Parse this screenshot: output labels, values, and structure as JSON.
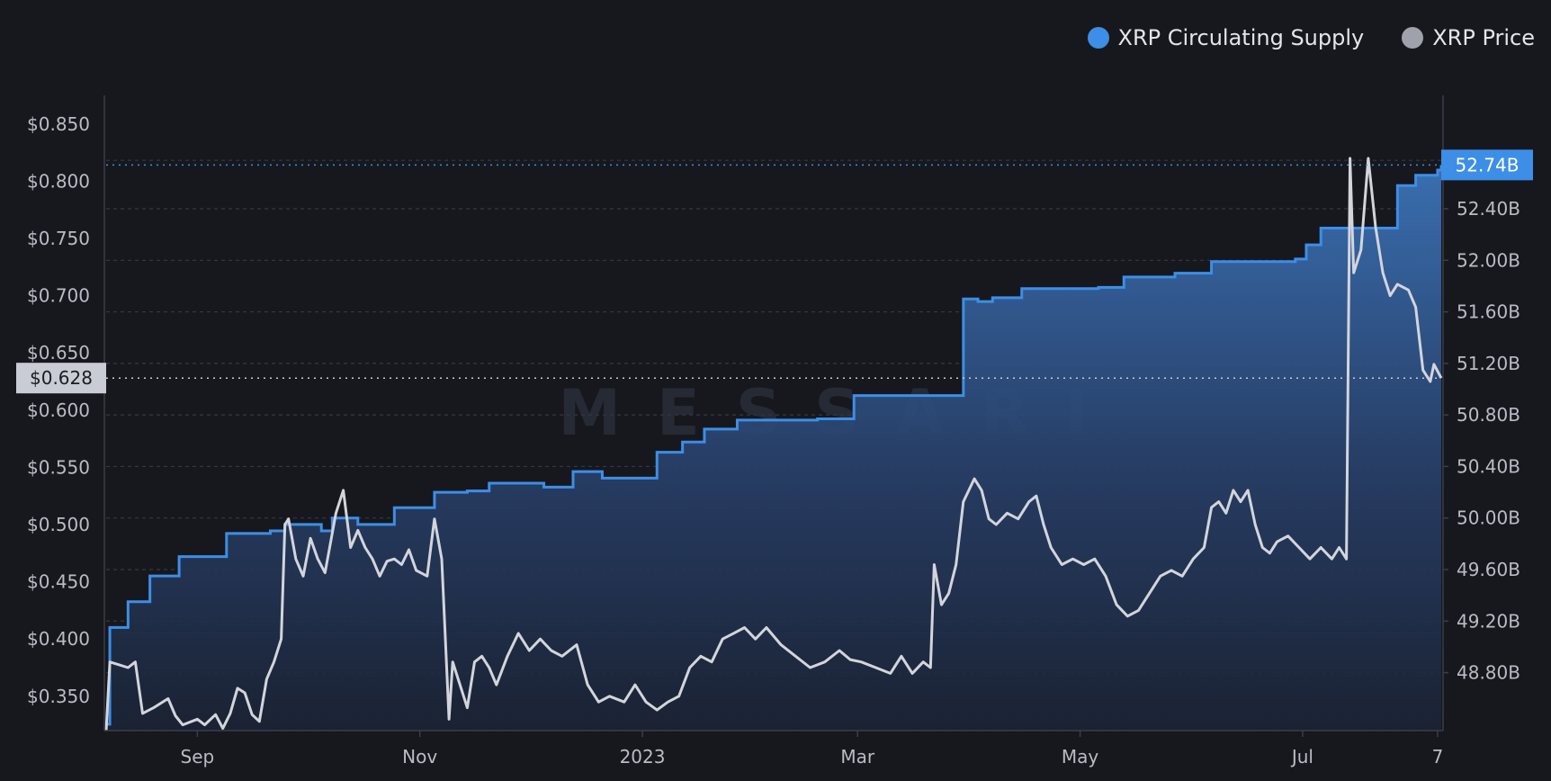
{
  "legend": {
    "supply_label": "XRP Circulating Supply",
    "price_label": "XRP Price"
  },
  "colors": {
    "supply": "#3d8ee6",
    "price": "#d3d5dc",
    "background": "#17181d",
    "price_badge_bg": "#c9ccd4",
    "supply_badge_bg": "#3d8ee6"
  },
  "watermark": "MESSARI",
  "chart_data": {
    "type": "line",
    "title": "",
    "xlabel": "",
    "x_ticks": [
      {
        "label": "Sep",
        "date": "2022-09-01"
      },
      {
        "label": "Nov",
        "date": "2022-11-01"
      },
      {
        "label": "2023",
        "date": "2023-01-01"
      },
      {
        "label": "Mar",
        "date": "2023-03-01"
      },
      {
        "label": "May",
        "date": "2023-05-01"
      },
      {
        "label": "Jul",
        "date": "2023-07-01"
      },
      {
        "label": "7",
        "date": "2023-08-07"
      }
    ],
    "x_range": [
      "2022-08-07",
      "2023-08-08"
    ],
    "y_left": {
      "ylim": [
        0.32,
        0.875
      ],
      "ticks": [
        "$0.350",
        "$0.400",
        "$0.450",
        "$0.500",
        "$0.550",
        "$0.600",
        "$0.650",
        "$0.700",
        "$0.750",
        "$0.800",
        "$0.850"
      ],
      "tick_values": [
        0.35,
        0.4,
        0.45,
        0.5,
        0.55,
        0.6,
        0.65,
        0.7,
        0.75,
        0.8,
        0.85
      ],
      "current_label": "$0.628",
      "current_value": 0.628
    },
    "y_right": {
      "ylim": [
        48.35,
        53.28
      ],
      "ticks": [
        "48.80B",
        "49.20B",
        "49.60B",
        "50.00B",
        "50.40B",
        "50.80B",
        "51.20B",
        "51.60B",
        "52.00B",
        "52.40B"
      ],
      "tick_values": [
        48.8,
        49.2,
        49.6,
        50.0,
        50.4,
        50.8,
        51.2,
        51.6,
        52.0,
        52.4
      ],
      "current_label": "52.74B",
      "current_value": 52.74
    },
    "series": [
      {
        "name": "XRP Circulating Supply",
        "axis": "right",
        "style": "step-area",
        "points": [
          [
            "2022-08-07",
            48.4
          ],
          [
            "2022-08-08",
            49.15
          ],
          [
            "2022-08-13",
            49.35
          ],
          [
            "2022-08-19",
            49.55
          ],
          [
            "2022-08-27",
            49.7
          ],
          [
            "2022-09-09",
            49.88
          ],
          [
            "2022-09-21",
            49.9
          ],
          [
            "2022-09-25",
            49.95
          ],
          [
            "2022-10-05",
            49.9
          ],
          [
            "2022-10-08",
            50.0
          ],
          [
            "2022-10-15",
            49.95
          ],
          [
            "2022-10-25",
            50.08
          ],
          [
            "2022-11-05",
            50.2
          ],
          [
            "2022-11-14",
            50.21
          ],
          [
            "2022-11-20",
            50.27
          ],
          [
            "2022-12-05",
            50.24
          ],
          [
            "2022-12-13",
            50.36
          ],
          [
            "2022-12-21",
            50.31
          ],
          [
            "2023-01-05",
            50.51
          ],
          [
            "2023-01-12",
            50.59
          ],
          [
            "2023-01-18",
            50.69
          ],
          [
            "2023-01-27",
            50.76
          ],
          [
            "2023-02-18",
            50.77
          ],
          [
            "2023-02-28",
            50.95
          ],
          [
            "2023-03-30",
            51.7
          ],
          [
            "2023-04-03",
            51.68
          ],
          [
            "2023-04-07",
            51.71
          ],
          [
            "2023-04-15",
            51.78
          ],
          [
            "2023-05-06",
            51.79
          ],
          [
            "2023-05-13",
            51.87
          ],
          [
            "2023-05-27",
            51.9
          ],
          [
            "2023-06-06",
            51.99
          ],
          [
            "2023-06-29",
            52.01
          ],
          [
            "2023-07-02",
            52.12
          ],
          [
            "2023-07-06",
            52.25
          ],
          [
            "2023-07-27",
            52.58
          ],
          [
            "2023-08-01",
            52.66
          ],
          [
            "2023-08-07",
            52.7
          ],
          [
            "2023-08-08",
            52.74
          ]
        ]
      },
      {
        "name": "XRP Price",
        "axis": "left",
        "style": "line",
        "points": [
          [
            "2022-08-07",
            0.32
          ],
          [
            "2022-08-08",
            0.38
          ],
          [
            "2022-08-10",
            0.378
          ],
          [
            "2022-08-13",
            0.375
          ],
          [
            "2022-08-15",
            0.38
          ],
          [
            "2022-08-17",
            0.335
          ],
          [
            "2022-08-20",
            0.34
          ],
          [
            "2022-08-24",
            0.348
          ],
          [
            "2022-08-26",
            0.333
          ],
          [
            "2022-08-28",
            0.325
          ],
          [
            "2022-09-01",
            0.33
          ],
          [
            "2022-09-03",
            0.325
          ],
          [
            "2022-09-06",
            0.334
          ],
          [
            "2022-09-08",
            0.322
          ],
          [
            "2022-09-10",
            0.335
          ],
          [
            "2022-09-12",
            0.357
          ],
          [
            "2022-09-14",
            0.353
          ],
          [
            "2022-09-16",
            0.334
          ],
          [
            "2022-09-18",
            0.328
          ],
          [
            "2022-09-20",
            0.365
          ],
          [
            "2022-09-22",
            0.38
          ],
          [
            "2022-09-24",
            0.4
          ],
          [
            "2022-09-25",
            0.5
          ],
          [
            "2022-09-26",
            0.505
          ],
          [
            "2022-09-28",
            0.47
          ],
          [
            "2022-09-30",
            0.455
          ],
          [
            "2022-10-02",
            0.488
          ],
          [
            "2022-10-04",
            0.47
          ],
          [
            "2022-10-06",
            0.458
          ],
          [
            "2022-10-09",
            0.51
          ],
          [
            "2022-10-11",
            0.53
          ],
          [
            "2022-10-13",
            0.48
          ],
          [
            "2022-10-15",
            0.495
          ],
          [
            "2022-10-17",
            0.48
          ],
          [
            "2022-10-19",
            0.47
          ],
          [
            "2022-10-21",
            0.455
          ],
          [
            "2022-10-23",
            0.468
          ],
          [
            "2022-10-25",
            0.47
          ],
          [
            "2022-10-27",
            0.465
          ],
          [
            "2022-10-29",
            0.478
          ],
          [
            "2022-10-31",
            0.46
          ],
          [
            "2022-11-03",
            0.455
          ],
          [
            "2022-11-05",
            0.505
          ],
          [
            "2022-11-07",
            0.47
          ],
          [
            "2022-11-09",
            0.33
          ],
          [
            "2022-11-10",
            0.38
          ],
          [
            "2022-11-12",
            0.36
          ],
          [
            "2022-11-14",
            0.34
          ],
          [
            "2022-11-16",
            0.38
          ],
          [
            "2022-11-18",
            0.385
          ],
          [
            "2022-11-20",
            0.375
          ],
          [
            "2022-11-22",
            0.36
          ],
          [
            "2022-11-25",
            0.385
          ],
          [
            "2022-11-28",
            0.405
          ],
          [
            "2022-12-01",
            0.39
          ],
          [
            "2022-12-04",
            0.4
          ],
          [
            "2022-12-07",
            0.39
          ],
          [
            "2022-12-10",
            0.385
          ],
          [
            "2022-12-14",
            0.395
          ],
          [
            "2022-12-17",
            0.36
          ],
          [
            "2022-12-20",
            0.345
          ],
          [
            "2022-12-23",
            0.35
          ],
          [
            "2022-12-27",
            0.345
          ],
          [
            "2022-12-30",
            0.36
          ],
          [
            "2023-01-02",
            0.345
          ],
          [
            "2023-01-05",
            0.338
          ],
          [
            "2023-01-08",
            0.345
          ],
          [
            "2023-01-11",
            0.35
          ],
          [
            "2023-01-14",
            0.375
          ],
          [
            "2023-01-17",
            0.385
          ],
          [
            "2023-01-20",
            0.38
          ],
          [
            "2023-01-23",
            0.4
          ],
          [
            "2023-01-26",
            0.405
          ],
          [
            "2023-01-29",
            0.41
          ],
          [
            "2023-02-01",
            0.4
          ],
          [
            "2023-02-04",
            0.41
          ],
          [
            "2023-02-08",
            0.395
          ],
          [
            "2023-02-12",
            0.385
          ],
          [
            "2023-02-16",
            0.375
          ],
          [
            "2023-02-20",
            0.38
          ],
          [
            "2023-02-24",
            0.39
          ],
          [
            "2023-02-27",
            0.382
          ],
          [
            "2023-03-02",
            0.38
          ],
          [
            "2023-03-06",
            0.375
          ],
          [
            "2023-03-10",
            0.37
          ],
          [
            "2023-03-13",
            0.385
          ],
          [
            "2023-03-16",
            0.37
          ],
          [
            "2023-03-19",
            0.38
          ],
          [
            "2023-03-21",
            0.375
          ],
          [
            "2023-03-22",
            0.465
          ],
          [
            "2023-03-24",
            0.43
          ],
          [
            "2023-03-26",
            0.44
          ],
          [
            "2023-03-28",
            0.465
          ],
          [
            "2023-03-30",
            0.52
          ],
          [
            "2023-04-02",
            0.54
          ],
          [
            "2023-04-04",
            0.53
          ],
          [
            "2023-04-06",
            0.505
          ],
          [
            "2023-04-08",
            0.5
          ],
          [
            "2023-04-11",
            0.51
          ],
          [
            "2023-04-14",
            0.505
          ],
          [
            "2023-04-17",
            0.52
          ],
          [
            "2023-04-19",
            0.525
          ],
          [
            "2023-04-21",
            0.5
          ],
          [
            "2023-04-23",
            0.48
          ],
          [
            "2023-04-26",
            0.465
          ],
          [
            "2023-04-29",
            0.47
          ],
          [
            "2023-05-02",
            0.465
          ],
          [
            "2023-05-05",
            0.47
          ],
          [
            "2023-05-08",
            0.455
          ],
          [
            "2023-05-11",
            0.43
          ],
          [
            "2023-05-14",
            0.42
          ],
          [
            "2023-05-17",
            0.425
          ],
          [
            "2023-05-20",
            0.44
          ],
          [
            "2023-05-23",
            0.455
          ],
          [
            "2023-05-26",
            0.46
          ],
          [
            "2023-05-29",
            0.455
          ],
          [
            "2023-06-01",
            0.47
          ],
          [
            "2023-06-04",
            0.48
          ],
          [
            "2023-06-06",
            0.515
          ],
          [
            "2023-06-08",
            0.52
          ],
          [
            "2023-06-10",
            0.51
          ],
          [
            "2023-06-12",
            0.53
          ],
          [
            "2023-06-14",
            0.52
          ],
          [
            "2023-06-16",
            0.53
          ],
          [
            "2023-06-18",
            0.5
          ],
          [
            "2023-06-20",
            0.48
          ],
          [
            "2023-06-22",
            0.475
          ],
          [
            "2023-06-24",
            0.485
          ],
          [
            "2023-06-27",
            0.49
          ],
          [
            "2023-06-30",
            0.48
          ],
          [
            "2023-07-03",
            0.47
          ],
          [
            "2023-07-06",
            0.48
          ],
          [
            "2023-07-09",
            0.47
          ],
          [
            "2023-07-11",
            0.48
          ],
          [
            "2023-07-13",
            0.47
          ],
          [
            "2023-07-14",
            0.82
          ],
          [
            "2023-07-15",
            0.72
          ],
          [
            "2023-07-17",
            0.74
          ],
          [
            "2023-07-19",
            0.82
          ],
          [
            "2023-07-21",
            0.76
          ],
          [
            "2023-07-23",
            0.72
          ],
          [
            "2023-07-25",
            0.7
          ],
          [
            "2023-07-27",
            0.71
          ],
          [
            "2023-07-30",
            0.705
          ],
          [
            "2023-08-01",
            0.69
          ],
          [
            "2023-08-03",
            0.635
          ],
          [
            "2023-08-05",
            0.625
          ],
          [
            "2023-08-06",
            0.64
          ],
          [
            "2023-08-08",
            0.628
          ]
        ]
      }
    ]
  }
}
